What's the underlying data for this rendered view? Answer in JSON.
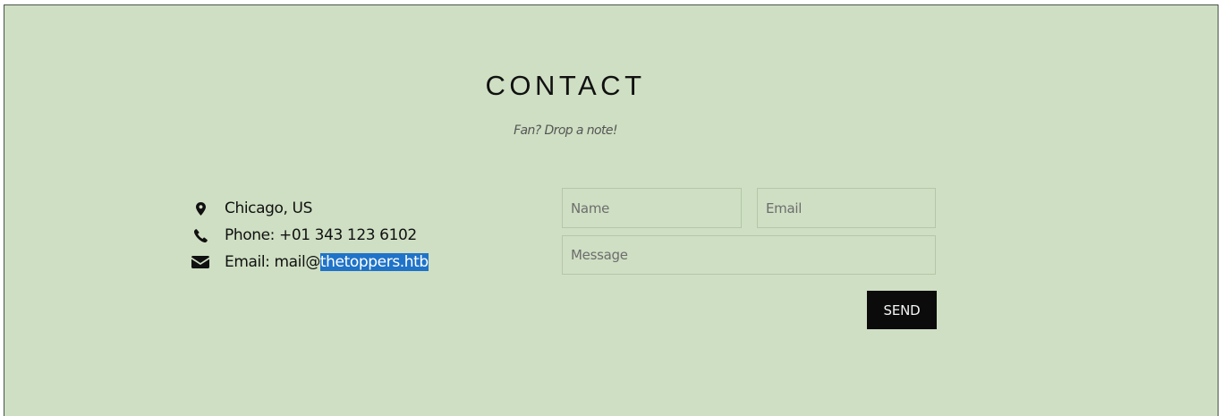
{
  "contact": {
    "title": "CONTACT",
    "subtitle": "Fan? Drop a note!"
  },
  "info": {
    "location": {
      "icon": "map-marker-icon",
      "text": "Chicago, US"
    },
    "phone": {
      "icon": "phone-icon",
      "text": "Phone: +01 343 123 6102"
    },
    "email": {
      "icon": "envelope-icon",
      "prefix": "Email: mail@",
      "selected": "thetoppers.htb"
    }
  },
  "form": {
    "name_placeholder": "Name",
    "email_placeholder": "Email",
    "message_placeholder": "Message",
    "send_label": "SEND"
  },
  "colors": {
    "background": "#cfdfc3",
    "selection": "#1f73c8",
    "button": "#0b0b0b"
  }
}
